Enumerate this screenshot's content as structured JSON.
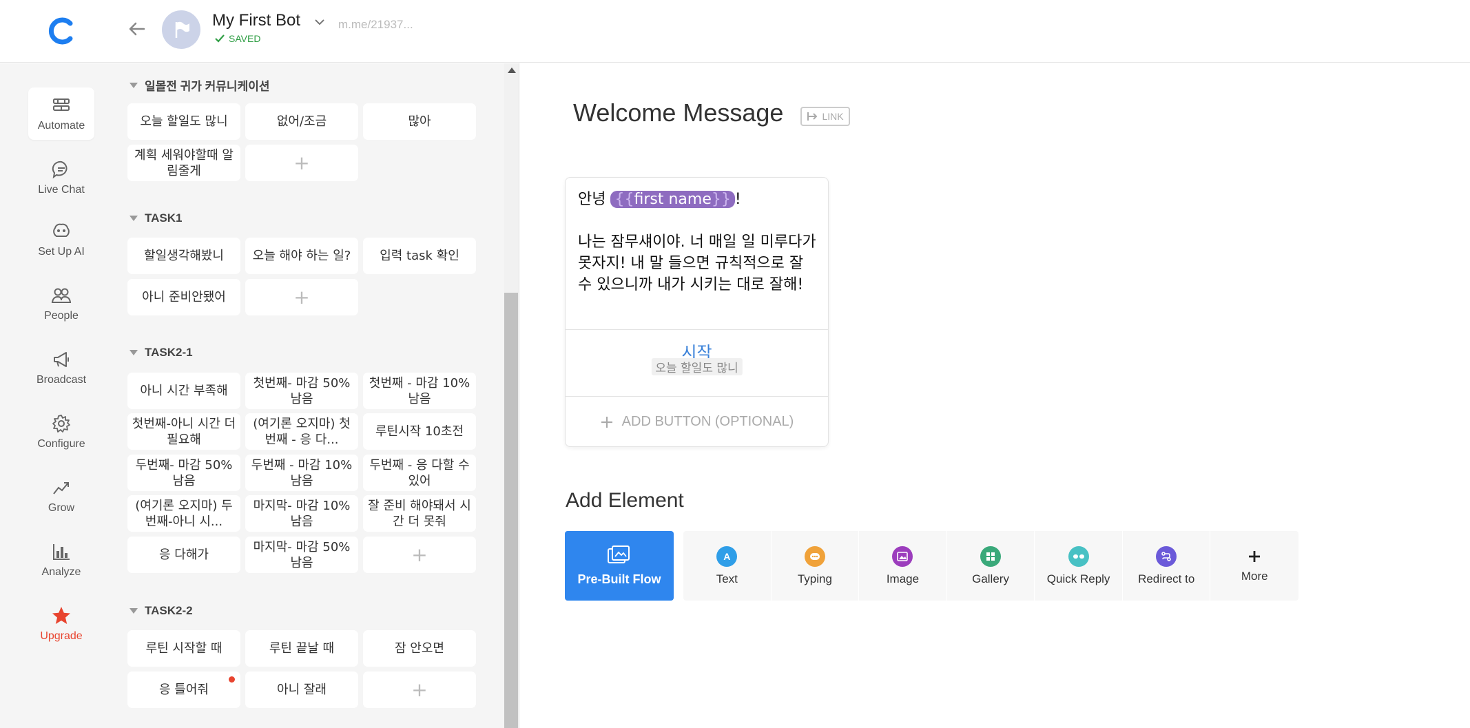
{
  "header": {
    "bot_name": "My First Bot",
    "saved_label": "SAVED",
    "bot_url": "m.me/21937..."
  },
  "nav": {
    "items": [
      {
        "label": "Automate",
        "icon": "automate-icon"
      },
      {
        "label": "Live Chat",
        "icon": "chat-icon"
      },
      {
        "label": "Set Up AI",
        "icon": "ai-icon"
      },
      {
        "label": "People",
        "icon": "people-icon"
      },
      {
        "label": "Broadcast",
        "icon": "megaphone-icon"
      },
      {
        "label": "Configure",
        "icon": "gear-icon"
      },
      {
        "label": "Grow",
        "icon": "grow-icon"
      },
      {
        "label": "Analyze",
        "icon": "bar-chart-icon"
      },
      {
        "label": "Upgrade",
        "icon": "star-icon"
      }
    ]
  },
  "groups": [
    {
      "title": "일몰전 귀가 커뮤니케이션",
      "blocks": [
        "오늘 할일도 많니",
        "없어/조금",
        "많아",
        "계획 세워야할때 알림줄게"
      ]
    },
    {
      "title": "TASK1",
      "blocks": [
        "할일생각해봤니",
        "오늘 해야 하는 일?",
        "입력 task 확인",
        "아니 준비안됐어"
      ]
    },
    {
      "title": "TASK2-1",
      "blocks": [
        "아니 시간 부족해",
        "첫번째- 마감 50%남음",
        "첫번째 - 마감 10%남음",
        "첫번째-아니 시간 더 필요해",
        "(여기론 오지마) 첫번째 - 응 다...",
        "루틴시작 10초전",
        "두번째- 마감 50%남음",
        "두번째 - 마감 10%남음",
        "두번째 - 응 다할 수 있어",
        "(여기론 오지마) 두번째-아니 시...",
        "마지막- 마감 10%남음",
        "잘 준비 해야돼서 시간 더 못줘",
        "응 다해가",
        "마지막- 마감 50%남음"
      ]
    },
    {
      "title": "TASK2-2",
      "blocks": [
        "루틴 시작할 때",
        "루틴 끝날 때",
        "잠 안오면",
        "응 틀어줘",
        "아니 잘래"
      ]
    }
  ],
  "add_block_symbol": "+",
  "editor": {
    "title": "Welcome Message",
    "link_label": "LINK",
    "message_greeting": "안녕 ",
    "var_open": "{{",
    "var_name": "first name",
    "var_close": "}}",
    "message_exclaim": "!",
    "message_body": "나는 잠무섀이야. 너 매일 일 미루다가 못자지! 내 말 들으면 규칙적으로 잘 수 있으니까 내가 시키는 대로 잘해!",
    "button_title": "시작",
    "button_target": "오늘 할일도 많니",
    "add_button_label": "ADD BUTTON (OPTIONAL)",
    "add_element_title": "Add Element",
    "prebuilt_label": "Pre-Built Flow",
    "elements": [
      {
        "label": "Text",
        "icon": "text-icon",
        "color": "#2f9ee8"
      },
      {
        "label": "Typing",
        "icon": "typing-icon",
        "color": "#f0a23a"
      },
      {
        "label": "Image",
        "icon": "image-icon",
        "color": "#9c3dbd"
      },
      {
        "label": "Gallery",
        "icon": "gallery-icon",
        "color": "#3aa97a"
      },
      {
        "label": "Quick Reply",
        "icon": "quick-reply-icon",
        "color": "#48c1c4"
      },
      {
        "label": "Redirect to",
        "icon": "redirect-icon",
        "color": "#6b5ad9"
      },
      {
        "label": "More",
        "icon": "plus-icon",
        "color": "#222222"
      }
    ]
  },
  "colors": {
    "accent": "#2f86ee",
    "saved": "#2f9e44",
    "upgrade": "#e8442f",
    "variable_chip": "#8e6cc0"
  }
}
